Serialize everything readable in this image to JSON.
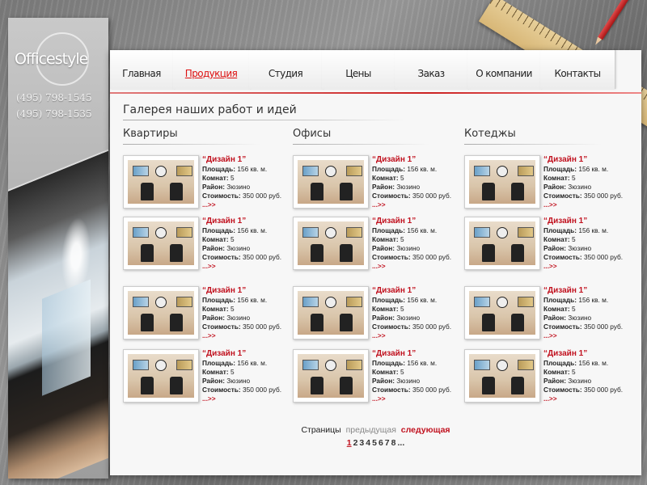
{
  "brand": {
    "logo": "Officestyle"
  },
  "contacts": {
    "phone1": "(495) 798-1545",
    "phone2": "(495) 798-1535"
  },
  "nav": [
    {
      "label": "Главная",
      "active": false
    },
    {
      "label": "Продукция",
      "active": true
    },
    {
      "label": "Студия",
      "active": false
    },
    {
      "label": "Цены",
      "active": false
    },
    {
      "label": "Заказ",
      "active": false
    },
    {
      "label": "О компании",
      "active": false
    },
    {
      "label": "Контакты",
      "active": false
    }
  ],
  "gallery": {
    "title": "Галерея наших работ и идей"
  },
  "columns": [
    "Квартиры",
    "Офисы",
    "Котеджы"
  ],
  "card": {
    "title": "“Дизайн 1”",
    "area_label": "Площадь:",
    "area_value": "156 кв. м.",
    "rooms_label": "Комнат:",
    "rooms_value": "5",
    "district_label": "Район:",
    "district_value": "Зюзино",
    "price_label": "Стоимость:",
    "price_value": "350 000 руб.",
    "more": "...>>"
  },
  "pager": {
    "label": "Страницы",
    "prev": "предыдущая",
    "next": "следующая",
    "pages": [
      "1",
      "2",
      "3",
      "4",
      "5",
      "6",
      "7",
      "8",
      "..."
    ],
    "current": "1"
  },
  "colors": {
    "accent": "#c1121f",
    "paper": "#f7f7f7"
  }
}
